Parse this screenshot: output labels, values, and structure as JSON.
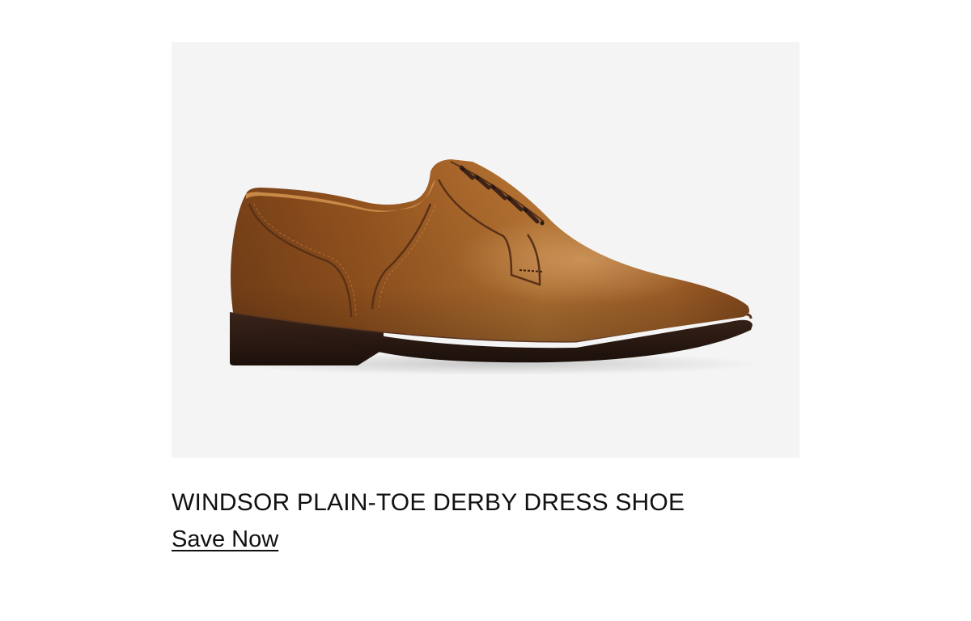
{
  "product": {
    "image_label": "shoe-product-image",
    "title": "WINDSOR PLAIN-TOE DERBY DRESS SHOE",
    "cta_label": "Save Now"
  },
  "colors": {
    "image_background": "#f4f4f4",
    "leather": "#a0622a",
    "sole": "#2a1a14",
    "laces": "#4a2a1e",
    "text": "#111111"
  }
}
